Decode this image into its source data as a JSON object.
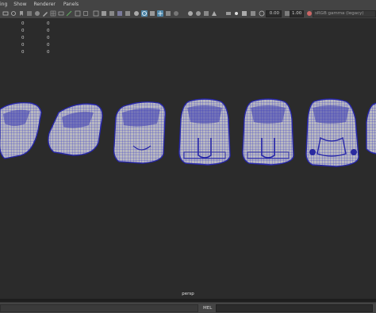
{
  "menubar": {
    "items": [
      "ing",
      "Show",
      "Renderer",
      "Panels"
    ]
  },
  "toolbar": {
    "field_a": "0.00",
    "field_b": "1.00",
    "colorspace": "sRGB gamma (legacy)"
  },
  "hud": {
    "rows": [
      [
        "0",
        "0"
      ],
      [
        "0",
        "0"
      ],
      [
        "0",
        "0"
      ],
      [
        "0",
        "0"
      ],
      [
        "0",
        "0"
      ]
    ]
  },
  "viewport": {
    "camera_label": "persp"
  },
  "cmdline": {
    "mel_label": "MEL"
  },
  "colors": {
    "ui_panel": "#444444",
    "viewport_bg": "#2b2b2b",
    "wire": "#3a3ad0",
    "surface": "#b7b7bd",
    "active_icon": "#4e86a8"
  }
}
